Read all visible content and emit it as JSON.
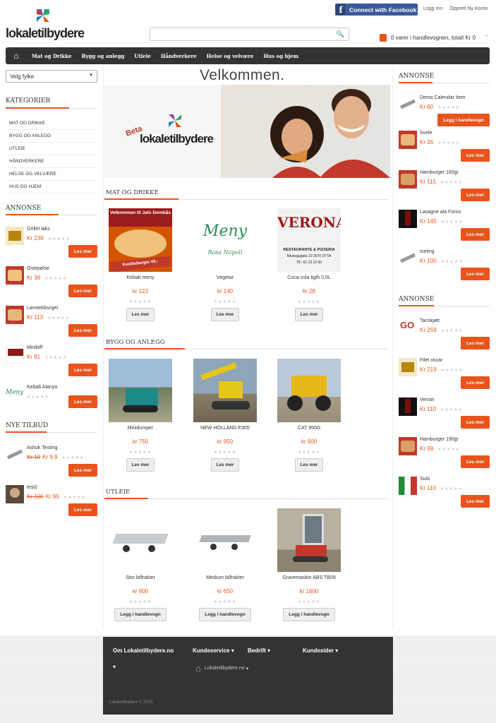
{
  "header": {
    "facebook_label": "Connect with Facebook",
    "login": "Logg Inn",
    "register": "Opprett Ny Konto",
    "logo_text": "lokaletilbydere",
    "cart_text": "0 varer i handlevognen, totalt Kr 0"
  },
  "nav": {
    "items": [
      "Mat og Drikke",
      "Bygg og anlegg",
      "Utleie",
      "Håndverkere",
      "Helse og velvære",
      "Hus og hjem"
    ]
  },
  "left": {
    "county_select": "Velg fylke",
    "categories_title": "KATEGORIER",
    "categories": [
      "MAT OG DRIKKE",
      "BYGG OG ANLEGG",
      "UTLEIE",
      "HÅNDVERKERE",
      "HELSE OG VELVÆRE",
      "HUS OG HJEM"
    ],
    "ads_title": "ANNONSE",
    "ads": [
      {
        "title": "Grillet laks",
        "price": "Kr 239",
        "button": "Les mer"
      },
      {
        "title": "Ostepølse",
        "price": "Kr 39",
        "button": "Les mer"
      },
      {
        "title": "Løvstekburger",
        "price": "Kr 113",
        "button": "Les mer"
      },
      {
        "title": "Minibiff",
        "price": "Kr 81",
        "button": "Les mer"
      },
      {
        "title": "Kebab Alanya",
        "price": "",
        "button": "Les mer"
      }
    ],
    "offers_title": "NYE TILBUD",
    "offers": [
      {
        "title": "Ashok Testing",
        "old_price": "Kr 10",
        "price": "Kr 9.9",
        "button": "Les mer"
      },
      {
        "title": "test2",
        "old_price": "Kr 100",
        "price": "Kr 95",
        "button": "Les mer"
      }
    ]
  },
  "center": {
    "welcome": "Velkommen.",
    "banner_beta": "Beta",
    "banner_logo": "lokaletilbydere",
    "sections": [
      {
        "title": "MAT OG DRIKKE",
        "products": [
          {
            "name": "Kebab meny",
            "price": "kr 123",
            "button": "Les mer"
          },
          {
            "name": "Vegetar",
            "price": "kr 140",
            "button": "Les mer"
          },
          {
            "name": "Coca cola ligth 0,5L",
            "price": "kr 28",
            "button": "Les mer"
          }
        ]
      },
      {
        "title": "BYGG OG ANLEGG",
        "products": [
          {
            "name": "Minidumper",
            "price": "kr 750",
            "button": "Les mer"
          },
          {
            "name": "NEW HOLLAND E305",
            "price": "kr 950",
            "button": "Les mer"
          },
          {
            "name": "CAT 950G",
            "price": "kr 900",
            "button": "Les mer"
          }
        ]
      },
      {
        "title": "UTLEIE",
        "products": [
          {
            "name": "Stor bilfrakter",
            "price": "kr 800",
            "button": "Legg i handlevogn"
          },
          {
            "name": "Medium bilfrakter",
            "price": "kr 650",
            "button": "Legg i handlevogn"
          },
          {
            "name": "Gravemaskin ABS TB09",
            "price": "kr 1600",
            "button": "Legg i handlevogn"
          }
        ]
      }
    ],
    "img_text": {
      "kebab_title": "Velkommen til Jafs Dombås",
      "kebab_sub": "Kveldsburger 49,-",
      "meny": "Meny",
      "rosa": "Rosa Napoli",
      "verona": "VERONA",
      "verona_sub": "RESTAURANTE & PIZZERIA",
      "verona_addr": "Mostugugata 10 2670 OTTA",
      "verona_tel": "Tlf.: 61 23 10 00"
    }
  },
  "right": {
    "ads1_title": "ANNONSE",
    "ads1": [
      {
        "title": "Demo Calendar Item",
        "price": "Kr 60",
        "button": "Legg i handlevogn"
      },
      {
        "title": "Svele",
        "price": "Kr 26",
        "button": "Les mer"
      },
      {
        "title": "Hamburger 160gr",
        "price": "Kr 115",
        "button": "Les mer"
      },
      {
        "title": "Lasagne ala Forno",
        "price": "Kr 145",
        "button": "Les mer"
      },
      {
        "title": "tseting",
        "price": "Kr 100",
        "button": "Les mer"
      }
    ],
    "ads2_title": "ANNONSE",
    "ads2": [
      {
        "title": "Tacokjøtt",
        "price": "Kr 259",
        "button": "Les mer"
      },
      {
        "title": "Filet oscar",
        "price": "Kr 219",
        "button": "Les mer"
      },
      {
        "title": "Verran",
        "price": "Kr 110",
        "button": "Les mer"
      },
      {
        "title": "Hamburger 190gr",
        "price": "Kr 99",
        "button": "Les mer"
      },
      {
        "title": "Sula",
        "price": "Kr 110",
        "button": "Les mer"
      }
    ]
  },
  "footer": {
    "about": "Om Lokaletilbydere.no",
    "customer_service": "Kundeservice",
    "company": "Bedrift",
    "customer_pages": "Kundesider",
    "site_link": "Lokaletilbydere.no",
    "copyright": "Lokaletilbydere © 2015"
  },
  "colors": {
    "accent": "#e8541c",
    "nav_bg": "#333333",
    "facebook": "#3b5998"
  }
}
